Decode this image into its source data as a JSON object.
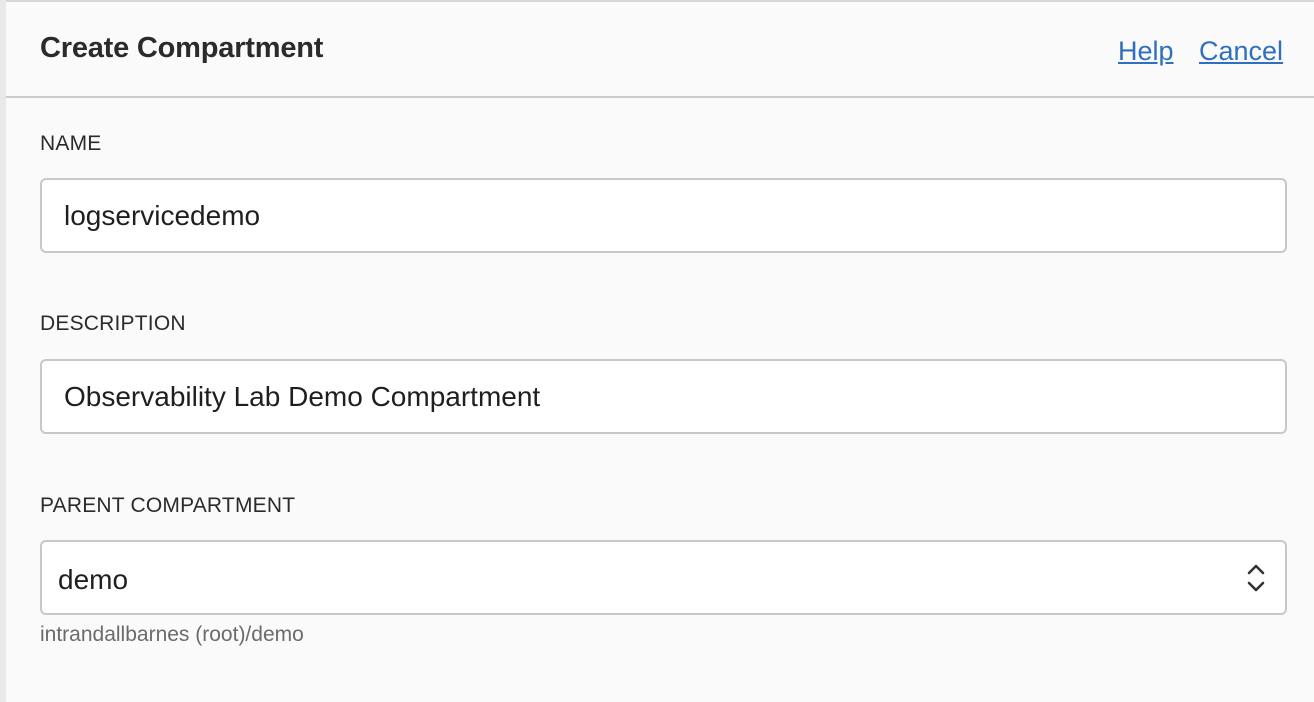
{
  "dialog": {
    "title": "Create Compartment",
    "help_link": "Help",
    "cancel_link": "Cancel"
  },
  "form": {
    "name": {
      "label": "NAME",
      "value": "logservicedemo"
    },
    "description": {
      "label": "DESCRIPTION",
      "value": "Observability Lab Demo Compartment"
    },
    "parent_compartment": {
      "label": "PARENT COMPARTMENT",
      "selected": "demo",
      "path_hint": "intrandallbarnes (root)/demo"
    }
  },
  "icons": {
    "select_arrows": "up-down-chevron-icon"
  },
  "colors": {
    "link": "#2f6fbf",
    "panel_background": "#fafafa",
    "field_border": "#c8c8c8"
  }
}
